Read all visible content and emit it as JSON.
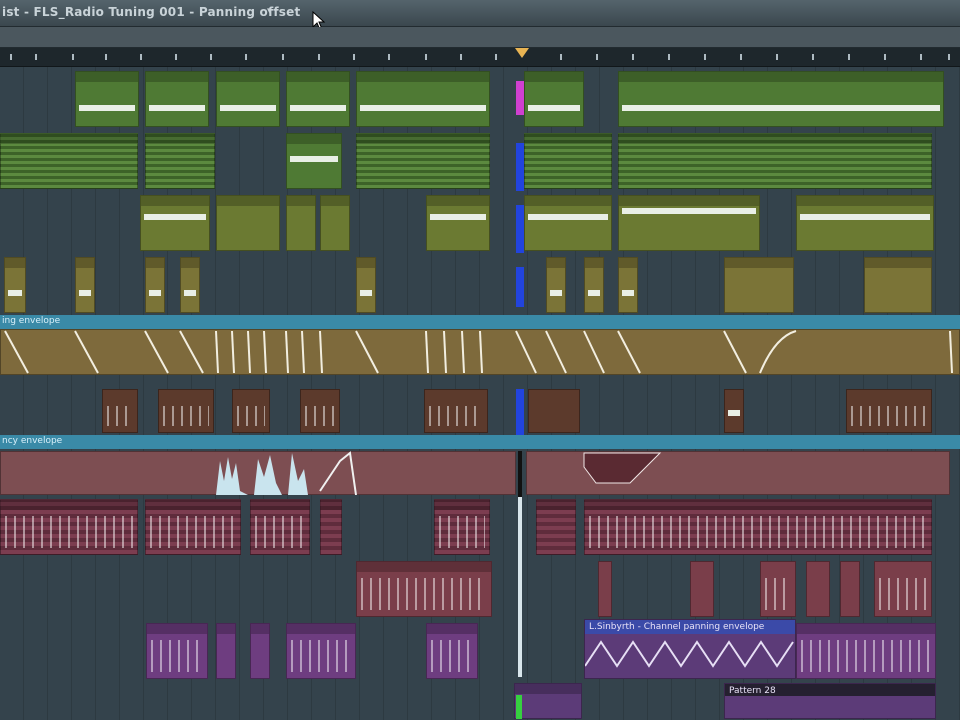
{
  "window": {
    "title": "ist - FLS_Radio Tuning 001 - Panning offset",
    "title_arrow": "▾"
  },
  "automation_lanes": [
    {
      "label": "ing envelope"
    },
    {
      "label": "ncy envelope"
    }
  ],
  "clips": {
    "lfo_clip_label": "L.Sinbyrth - Channel panning envelope",
    "bottom_clip_label": "Pattern 28"
  },
  "colors": {
    "background": "#34434c",
    "ruler": "#1e272c",
    "automation_header": "#3a8aa7",
    "playhead": "#e8b453",
    "selection_pink": "#d040d0",
    "selection_blue": "#2244dd",
    "green_clip": "#4f7a34",
    "maroon_clip": "#7a3e4a",
    "purple_clip": "#6e3d80"
  },
  "icons": [
    "mouse-pointer-icon",
    "dropdown-arrow-icon",
    "playhead-marker-icon"
  ]
}
